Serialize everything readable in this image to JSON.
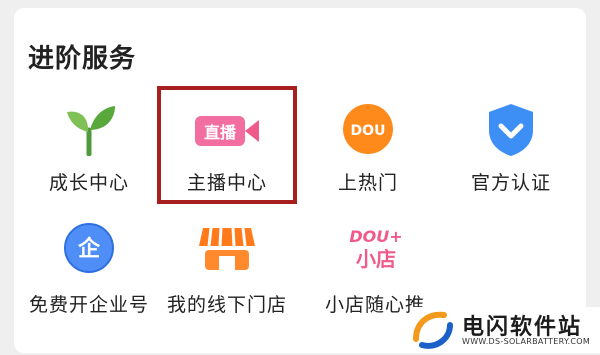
{
  "section": {
    "title": "进阶服务"
  },
  "services": [
    {
      "label": "成长中心",
      "icon": "sprout-icon"
    },
    {
      "label": "主播中心",
      "icon": "live-camera-icon",
      "badge": "直播"
    },
    {
      "label": "上热门",
      "icon": "dou-plus-circle-icon",
      "badge": "DOU"
    },
    {
      "label": "官方认证",
      "icon": "verified-shield-icon"
    },
    {
      "label": "免费开企业号",
      "icon": "enterprise-icon",
      "badge": "企"
    },
    {
      "label": "我的线下门店",
      "icon": "storefront-icon"
    },
    {
      "label": "小店随心推",
      "icon": "dou-plus-shop-icon",
      "badge_top": "DOU+",
      "badge_bottom": "小店"
    }
  ],
  "watermark": {
    "title": "电闪软件站",
    "url": "WWW.DS-SOLARBATTERY.COM"
  },
  "colors": {
    "highlight": "#a81f1f",
    "accent_pink": "#f05a8a",
    "accent_orange": "#ff7a1a",
    "accent_blue": "#3d8ff5"
  }
}
